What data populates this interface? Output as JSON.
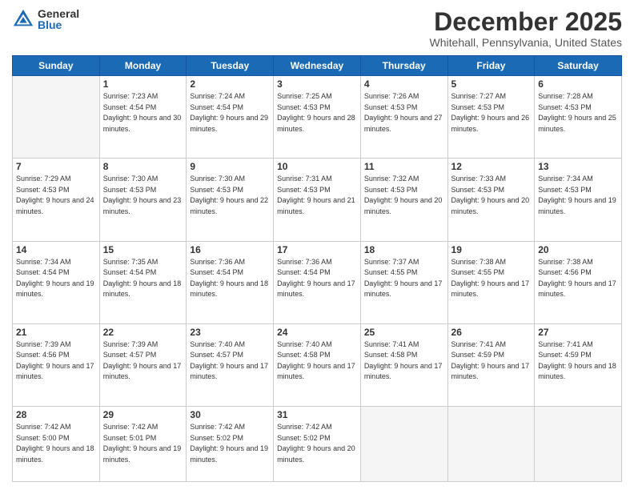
{
  "logo": {
    "general": "General",
    "blue": "Blue"
  },
  "header": {
    "month": "December 2025",
    "location": "Whitehall, Pennsylvania, United States"
  },
  "weekdays": [
    "Sunday",
    "Monday",
    "Tuesday",
    "Wednesday",
    "Thursday",
    "Friday",
    "Saturday"
  ],
  "weeks": [
    [
      {
        "day": "",
        "sunrise": "",
        "sunset": "",
        "daylight": ""
      },
      {
        "day": "1",
        "sunrise": "7:23 AM",
        "sunset": "4:54 PM",
        "daylight": "9 hours and 30 minutes."
      },
      {
        "day": "2",
        "sunrise": "7:24 AM",
        "sunset": "4:54 PM",
        "daylight": "9 hours and 29 minutes."
      },
      {
        "day": "3",
        "sunrise": "7:25 AM",
        "sunset": "4:53 PM",
        "daylight": "9 hours and 28 minutes."
      },
      {
        "day": "4",
        "sunrise": "7:26 AM",
        "sunset": "4:53 PM",
        "daylight": "9 hours and 27 minutes."
      },
      {
        "day": "5",
        "sunrise": "7:27 AM",
        "sunset": "4:53 PM",
        "daylight": "9 hours and 26 minutes."
      },
      {
        "day": "6",
        "sunrise": "7:28 AM",
        "sunset": "4:53 PM",
        "daylight": "9 hours and 25 minutes."
      }
    ],
    [
      {
        "day": "7",
        "sunrise": "7:29 AM",
        "sunset": "4:53 PM",
        "daylight": "9 hours and 24 minutes."
      },
      {
        "day": "8",
        "sunrise": "7:30 AM",
        "sunset": "4:53 PM",
        "daylight": "9 hours and 23 minutes."
      },
      {
        "day": "9",
        "sunrise": "7:30 AM",
        "sunset": "4:53 PM",
        "daylight": "9 hours and 22 minutes."
      },
      {
        "day": "10",
        "sunrise": "7:31 AM",
        "sunset": "4:53 PM",
        "daylight": "9 hours and 21 minutes."
      },
      {
        "day": "11",
        "sunrise": "7:32 AM",
        "sunset": "4:53 PM",
        "daylight": "9 hours and 20 minutes."
      },
      {
        "day": "12",
        "sunrise": "7:33 AM",
        "sunset": "4:53 PM",
        "daylight": "9 hours and 20 minutes."
      },
      {
        "day": "13",
        "sunrise": "7:34 AM",
        "sunset": "4:53 PM",
        "daylight": "9 hours and 19 minutes."
      }
    ],
    [
      {
        "day": "14",
        "sunrise": "7:34 AM",
        "sunset": "4:54 PM",
        "daylight": "9 hours and 19 minutes."
      },
      {
        "day": "15",
        "sunrise": "7:35 AM",
        "sunset": "4:54 PM",
        "daylight": "9 hours and 18 minutes."
      },
      {
        "day": "16",
        "sunrise": "7:36 AM",
        "sunset": "4:54 PM",
        "daylight": "9 hours and 18 minutes."
      },
      {
        "day": "17",
        "sunrise": "7:36 AM",
        "sunset": "4:54 PM",
        "daylight": "9 hours and 17 minutes."
      },
      {
        "day": "18",
        "sunrise": "7:37 AM",
        "sunset": "4:55 PM",
        "daylight": "9 hours and 17 minutes."
      },
      {
        "day": "19",
        "sunrise": "7:38 AM",
        "sunset": "4:55 PM",
        "daylight": "9 hours and 17 minutes."
      },
      {
        "day": "20",
        "sunrise": "7:38 AM",
        "sunset": "4:56 PM",
        "daylight": "9 hours and 17 minutes."
      }
    ],
    [
      {
        "day": "21",
        "sunrise": "7:39 AM",
        "sunset": "4:56 PM",
        "daylight": "9 hours and 17 minutes."
      },
      {
        "day": "22",
        "sunrise": "7:39 AM",
        "sunset": "4:57 PM",
        "daylight": "9 hours and 17 minutes."
      },
      {
        "day": "23",
        "sunrise": "7:40 AM",
        "sunset": "4:57 PM",
        "daylight": "9 hours and 17 minutes."
      },
      {
        "day": "24",
        "sunrise": "7:40 AM",
        "sunset": "4:58 PM",
        "daylight": "9 hours and 17 minutes."
      },
      {
        "day": "25",
        "sunrise": "7:41 AM",
        "sunset": "4:58 PM",
        "daylight": "9 hours and 17 minutes."
      },
      {
        "day": "26",
        "sunrise": "7:41 AM",
        "sunset": "4:59 PM",
        "daylight": "9 hours and 17 minutes."
      },
      {
        "day": "27",
        "sunrise": "7:41 AM",
        "sunset": "4:59 PM",
        "daylight": "9 hours and 18 minutes."
      }
    ],
    [
      {
        "day": "28",
        "sunrise": "7:42 AM",
        "sunset": "5:00 PM",
        "daylight": "9 hours and 18 minutes."
      },
      {
        "day": "29",
        "sunrise": "7:42 AM",
        "sunset": "5:01 PM",
        "daylight": "9 hours and 19 minutes."
      },
      {
        "day": "30",
        "sunrise": "7:42 AM",
        "sunset": "5:02 PM",
        "daylight": "9 hours and 19 minutes."
      },
      {
        "day": "31",
        "sunrise": "7:42 AM",
        "sunset": "5:02 PM",
        "daylight": "9 hours and 20 minutes."
      },
      {
        "day": "",
        "sunrise": "",
        "sunset": "",
        "daylight": ""
      },
      {
        "day": "",
        "sunrise": "",
        "sunset": "",
        "daylight": ""
      },
      {
        "day": "",
        "sunrise": "",
        "sunset": "",
        "daylight": ""
      }
    ]
  ],
  "labels": {
    "sunrise": "Sunrise:",
    "sunset": "Sunset:",
    "daylight": "Daylight:"
  }
}
